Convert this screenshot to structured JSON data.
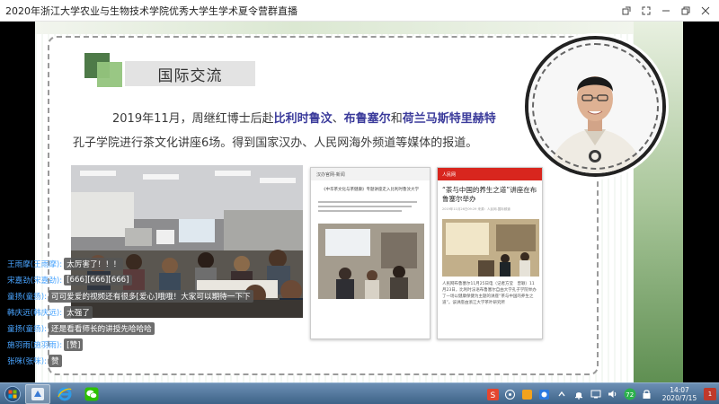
{
  "window": {
    "title": "2020年浙江大学农业与生物技术学院优秀大学生学术夏令营群直播"
  },
  "slide": {
    "heading": "国际交流",
    "para1_prefix": "2019年11月，周继红博士后赴",
    "place1": "比利时鲁汶",
    "sep1": "、",
    "place2": "布鲁塞尔",
    "and": "和",
    "place3": "荷兰马斯特里赫特",
    "para2": "孔子学院进行茶文化讲座6场。得到国家汉办、人民网海外频道等媒体的报道。",
    "news1": {
      "site": "汉办官网-新闻",
      "headline": "《中华茶文化与茶健康》专题讲座走入比利时鲁汶大学"
    },
    "news2": {
      "site": "人民网",
      "headline": "“茶与中国的养生之道”讲座在布鲁塞尔举办",
      "meta": "2019年11月26日09:29  来源：人民网-国际频道",
      "body": "人民网布鲁塞尔11月25日电（记者方莹　曾颖）11月23日，比利时法语布鲁塞尔自由大学孔子学院举办了一场以健康保健为主题的讲座“茶与中国的养生之道”。该讲座由浙江大学茶叶研究所"
    }
  },
  "chat": [
    {
      "name": "王雨摩(王雨摩):",
      "msg": "太厉害了！！！"
    },
    {
      "name": "宋嘉劲(宋嘉劲):",
      "msg": "[666][666][666]"
    },
    {
      "name": "童扬(童扬):",
      "msg": "可可爱爱的视频还有很多[爱心]哦哦！大家可以期待一下下"
    },
    {
      "name": "韩庆远(韩庆远):",
      "msg": "太强了"
    },
    {
      "name": "童扬(童扬):",
      "msg": "还是看看师长的讲授先哈哈哈"
    },
    {
      "name": "施羽雨(施羽雨):",
      "msg": "[赞]"
    },
    {
      "name": "张咪(张咪):",
      "msg": "赞"
    }
  ],
  "taskbar": {
    "time": "14:07",
    "date": "2020/7/15",
    "tray_badge": "72",
    "notif_count": "1"
  },
  "colors": {
    "accent_dark_green": "#4e7a48",
    "accent_light_green": "#93c47d",
    "highlight_blue": "#3b3b9b",
    "chat_name": "#49a4ff",
    "people_red": "#d8261e"
  }
}
